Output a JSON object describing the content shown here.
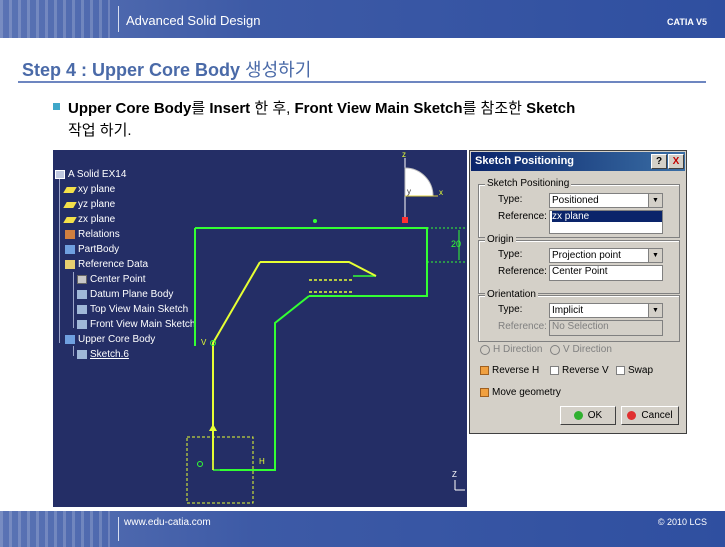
{
  "header": {
    "title": "Advanced Solid Design",
    "brand": "CATIA V5"
  },
  "step": {
    "title_prefix": "Step 4 : Upper Core Body ",
    "title_suffix": "생성하기"
  },
  "instruction": {
    "part1": "Upper Core Body",
    "part2": "를 ",
    "part3": "Insert",
    "part4": " 한 후,  ",
    "part5": "Front View Main Sketch",
    "part6": "를 참조한 ",
    "part7": "Sketch",
    "line2": "작업 하기."
  },
  "tree": {
    "items": [
      {
        "label": "A Solid EX14",
        "icon": "part-icon"
      },
      {
        "label": "xy plane",
        "icon": "plane-icon"
      },
      {
        "label": "yz plane",
        "icon": "plane-icon"
      },
      {
        "label": "zx plane",
        "icon": "plane-icon"
      },
      {
        "label": "Relations",
        "icon": "relations-icon"
      },
      {
        "label": "PartBody",
        "icon": "body-icon"
      },
      {
        "label": "Reference Data",
        "icon": "geoset-icon"
      },
      {
        "label": "Center Point",
        "icon": "point-icon"
      },
      {
        "label": "Datum Plane Body",
        "icon": "sketch-icon"
      },
      {
        "label": "Top View Main Sketch",
        "icon": "sketch-icon"
      },
      {
        "label": "Front View Main Sketch",
        "icon": "sketch-icon"
      },
      {
        "label": "Upper Core Body",
        "icon": "body-icon"
      },
      {
        "label": "Sketch.6",
        "icon": "sketch-icon"
      }
    ]
  },
  "viewport": {
    "dimension": "20",
    "axis_h": "H",
    "axis_v": "V",
    "compass_x": "x",
    "compass_y": "y",
    "compass_z": "z",
    "bottom_z": "Z"
  },
  "dialog": {
    "title": "Sketch Positioning",
    "help_label": "?",
    "close_label": "X",
    "positioning": {
      "group_label": "Sketch Positioning",
      "type_label": "Type:",
      "type_value": "Positioned",
      "reference_label": "Reference:",
      "reference_value": "zx plane"
    },
    "origin": {
      "group_label": "Origin",
      "type_label": "Type:",
      "type_value": "Projection point",
      "reference_label": "Reference:",
      "reference_value": "Center Point"
    },
    "orientation": {
      "group_label": "Orientation",
      "type_label": "Type:",
      "type_value": "Implicit",
      "reference_label": "Reference:",
      "reference_value": "No Selection"
    },
    "h_direction": "H Direction",
    "v_direction": "V Direction",
    "reverse_h": "Reverse H",
    "reverse_v": "Reverse V",
    "swap": "Swap",
    "move_geometry": "Move geometry",
    "ok_label": "OK",
    "cancel_label": "Cancel"
  },
  "footer": {
    "site": "www.edu-catia.com",
    "copyright": "© 2010 LCS"
  },
  "colors": {
    "header_blue": "#3d5aa6",
    "title_blue": "#4a6aa8",
    "sketch_green": "#33ff33",
    "sketch_yellow": "#e6ff33",
    "viewport_bg": "#242e66"
  }
}
